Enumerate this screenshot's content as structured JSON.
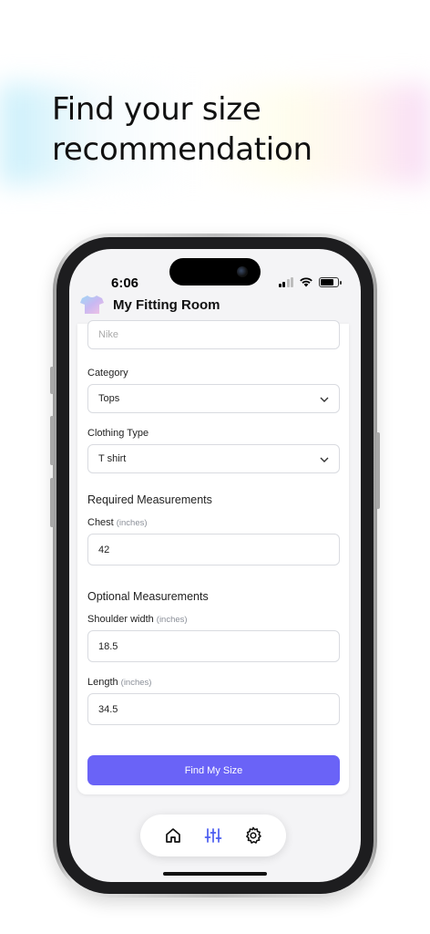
{
  "headline": {
    "line1": "Find your size",
    "line2": "recommendation"
  },
  "status": {
    "time": "6:06"
  },
  "app": {
    "title": "My Fitting Room",
    "logo": "tshirt-icon"
  },
  "form": {
    "brand_value": "Nike",
    "category_label": "Category",
    "category_value": "Tops",
    "clothing_type_label": "Clothing Type",
    "clothing_type_value": "T shirt",
    "required_heading": "Required Measurements",
    "chest_label": "Chest",
    "chest_unit": "(inches)",
    "chest_value": "42",
    "optional_heading": "Optional Measurements",
    "shoulder_label": "Shoulder width",
    "shoulder_unit": "(inches)",
    "shoulder_value": "18.5",
    "length_label": "Length",
    "length_unit": "(inches)",
    "length_value": "34.5",
    "submit_label": "Find My Size"
  },
  "tabs": [
    {
      "icon": "home-icon",
      "active": false
    },
    {
      "icon": "sliders-icon",
      "active": true
    },
    {
      "icon": "gear-icon",
      "active": false
    }
  ],
  "colors": {
    "accent": "#6a63f7",
    "active_tab": "#4a5cf0",
    "text": "#222222"
  }
}
